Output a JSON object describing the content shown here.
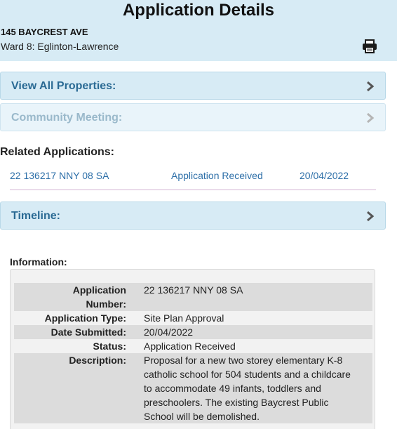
{
  "header": {
    "title": "Application Details",
    "address": "145 BAYCREST AVE",
    "ward": "Ward 8: Eglinton-Lawrence",
    "print_icon": "printer-icon"
  },
  "accordions": {
    "view_all_properties": "View All Properties:",
    "community_meeting": "Community Meeting:",
    "timeline": "Timeline:"
  },
  "related": {
    "heading": "Related Applications:",
    "items": [
      {
        "number": "22 136217 NNY 08 SA",
        "status": "Application Received",
        "date": "20/04/2022"
      }
    ]
  },
  "information": {
    "heading": "Information:",
    "rows": [
      {
        "label": "Application Number:",
        "value": "22 136217 NNY 08 SA"
      },
      {
        "label": "Application Type:",
        "value": "Site Plan Approval"
      },
      {
        "label": "Date Submitted:",
        "value": "20/04/2022"
      },
      {
        "label": "Status:",
        "value": "Application Received"
      },
      {
        "label": "Description:",
        "value": "Proposal for a new two storey elementary K-8 catholic school for 504 students and a childcare to accommodate 49 infants, toddlers and preschoolers. The existing Baycrest Public School will be demolished."
      }
    ]
  },
  "colors": {
    "header_bg": "#d7ebf5",
    "link": "#2d6fa8",
    "accordion_text": "#2a6a94"
  }
}
